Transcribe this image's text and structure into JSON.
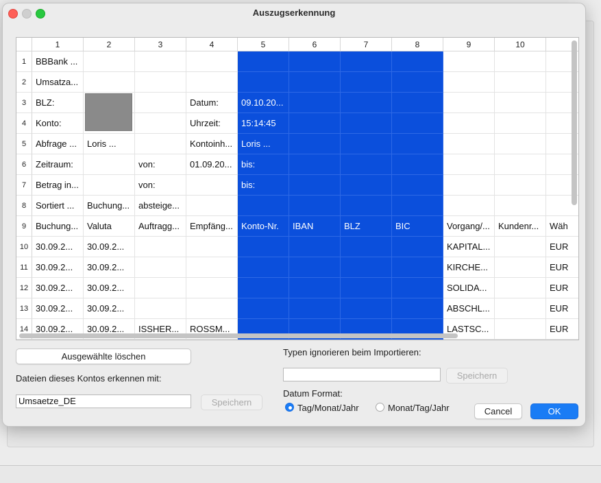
{
  "dialog": {
    "title": "Auszugserkennung"
  },
  "table": {
    "column_headers": [
      "1",
      "2",
      "3",
      "4",
      "5",
      "6",
      "7",
      "8",
      "9",
      "10",
      ""
    ],
    "selected_columns": [
      4,
      5,
      6,
      7
    ],
    "rows": [
      {
        "num": "1",
        "cells": [
          "BBBank ...",
          "",
          "",
          "",
          "",
          "",
          "",
          "",
          "",
          "",
          ""
        ]
      },
      {
        "num": "2",
        "cells": [
          "Umsatza...",
          "",
          "",
          "",
          "",
          "",
          "",
          "",
          "",
          "",
          ""
        ]
      },
      {
        "num": "3",
        "cells": [
          "BLZ:",
          "",
          "",
          "Datum:",
          "09.10.20...",
          "",
          "",
          "",
          "",
          "",
          ""
        ]
      },
      {
        "num": "4",
        "cells": [
          "Konto:",
          "",
          "",
          "Uhrzeit:",
          "15:14:45",
          "",
          "",
          "",
          "",
          "",
          ""
        ]
      },
      {
        "num": "5",
        "cells": [
          "Abfrage ...",
          "Loris ...",
          "",
          "Kontoinh...",
          "Loris ...",
          "",
          "",
          "",
          "",
          "",
          ""
        ]
      },
      {
        "num": "6",
        "cells": [
          "Zeitraum:",
          "",
          "von:",
          "01.09.20...",
          "bis:",
          "",
          "",
          "",
          "",
          "",
          ""
        ]
      },
      {
        "num": "7",
        "cells": [
          "Betrag in...",
          "",
          "von:",
          "",
          "bis:",
          "",
          "",
          "",
          "",
          "",
          ""
        ]
      },
      {
        "num": "8",
        "cells": [
          "Sortiert ...",
          "Buchung...",
          "absteige...",
          "",
          "",
          "",
          "",
          "",
          "",
          "",
          ""
        ]
      },
      {
        "num": "9",
        "cells": [
          "Buchung...",
          "Valuta",
          "Auftragg...",
          "Empfäng...",
          "Konto-Nr.",
          "IBAN",
          "BLZ",
          "BIC",
          "Vorgang/...",
          "Kundenr...",
          "Wäh"
        ]
      },
      {
        "num": "10",
        "cells": [
          "30.09.2...",
          "30.09.2...",
          "",
          "",
          "",
          "",
          "",
          "",
          "KAPITAL...",
          "",
          "EUR"
        ]
      },
      {
        "num": "11",
        "cells": [
          "30.09.2...",
          "30.09.2...",
          "",
          "",
          "",
          "",
          "",
          "",
          "KIRCHE...",
          "",
          "EUR"
        ]
      },
      {
        "num": "12",
        "cells": [
          "30.09.2...",
          "30.09.2...",
          "",
          "",
          "",
          "",
          "",
          "",
          "SOLIDA...",
          "",
          "EUR"
        ]
      },
      {
        "num": "13",
        "cells": [
          "30.09.2...",
          "30.09.2...",
          "",
          "",
          "",
          "",
          "",
          "",
          "ABSCHL...",
          "",
          "EUR"
        ]
      },
      {
        "num": "14",
        "cells": [
          "30.09.2...",
          "30.09.2...",
          "ISSHER...",
          "ROSSM...",
          "",
          "",
          "",
          "",
          "LASTSC...",
          "",
          "EUR"
        ]
      }
    ]
  },
  "buttons": {
    "delete_selected": "Ausgewählte löschen",
    "save_left": "Speichern",
    "save_right": "Speichern",
    "cancel": "Cancel",
    "ok": "OK"
  },
  "labels": {
    "recognize_with": "Dateien dieses Kontos erkennen mit:",
    "ignore_types": "Typen ignorieren beim Importieren:",
    "date_format": "Datum Format:"
  },
  "inputs": {
    "recognize_value": "Umsaetze_DE",
    "ignore_value": ""
  },
  "date_format_options": [
    {
      "label": "Tag/Monat/Jahr",
      "selected": true
    },
    {
      "label": "Monat/Tag/Jahr",
      "selected": false
    }
  ],
  "colors": {
    "selection": "#0b4fdc",
    "accent": "#1a7cf5"
  }
}
